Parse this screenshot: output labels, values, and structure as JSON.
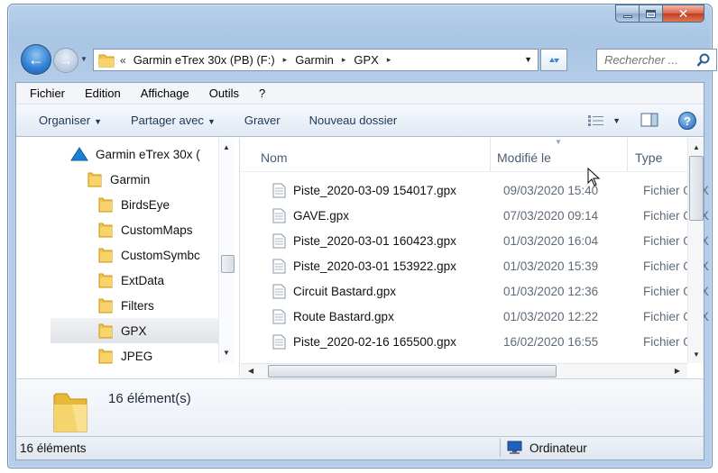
{
  "window": {
    "caption_buttons": {
      "minimize": "minimize-icon",
      "maximize": "maximize-icon",
      "close": "✕"
    }
  },
  "address_bar": {
    "overflow_glyph": "«",
    "crumbs": [
      "Garmin eTrex 30x (PB) (F:)",
      "Garmin",
      "GPX"
    ],
    "separator": "▸",
    "refresh_icon": "refresh-icon"
  },
  "search": {
    "placeholder": "Rechercher ..."
  },
  "menubar": {
    "items": [
      "Fichier",
      "Edition",
      "Affichage",
      "Outils",
      "?"
    ]
  },
  "toolbar": {
    "organize": "Organiser",
    "share": "Partager avec",
    "burn": "Graver",
    "new_folder": "Nouveau dossier"
  },
  "nav_tree": {
    "items": [
      {
        "label": "Garmin eTrex 30x (",
        "icon": "device-icon",
        "level": 0
      },
      {
        "label": "Garmin",
        "icon": "folder-icon",
        "level": 1
      },
      {
        "label": "BirdsEye",
        "icon": "folder-icon",
        "level": 2
      },
      {
        "label": "CustomMaps",
        "icon": "folder-icon",
        "level": 2
      },
      {
        "label": "CustomSymbc",
        "icon": "folder-icon",
        "level": 2
      },
      {
        "label": "ExtData",
        "icon": "folder-icon",
        "level": 2
      },
      {
        "label": "Filters",
        "icon": "folder-icon",
        "level": 2
      },
      {
        "label": "GPX",
        "icon": "folder-icon",
        "level": 2,
        "selected": true
      },
      {
        "label": "JPEG",
        "icon": "folder-icon",
        "level": 2
      }
    ]
  },
  "file_list": {
    "columns": {
      "name": "Nom",
      "modified": "Modifié le",
      "type": "Type"
    },
    "rows": [
      {
        "name": "Piste_2020-03-09 154017.gpx",
        "modified": "09/03/2020 15:40",
        "type": "Fichier GPX"
      },
      {
        "name": "GAVE.gpx",
        "modified": "07/03/2020 09:14",
        "type": "Fichier GPX"
      },
      {
        "name": "Piste_2020-03-01 160423.gpx",
        "modified": "01/03/2020 16:04",
        "type": "Fichier GPX"
      },
      {
        "name": "Piste_2020-03-01 153922.gpx",
        "modified": "01/03/2020 15:39",
        "type": "Fichier GPX"
      },
      {
        "name": "Circuit Bastard.gpx",
        "modified": "01/03/2020 12:36",
        "type": "Fichier GPX"
      },
      {
        "name": "Route Bastard.gpx",
        "modified": "01/03/2020 12:22",
        "type": "Fichier GPX"
      },
      {
        "name": "Piste_2020-02-16 165500.gpx",
        "modified": "16/02/2020 16:55",
        "type": "Fichier GPX"
      }
    ]
  },
  "details": {
    "count": "16 élément(s)"
  },
  "status": {
    "left": "16 éléments",
    "computer": "Ordinateur"
  },
  "colors": {
    "accent": "#2f7ed2",
    "folder": "#f3c547",
    "selection": "#e3e6ea"
  }
}
